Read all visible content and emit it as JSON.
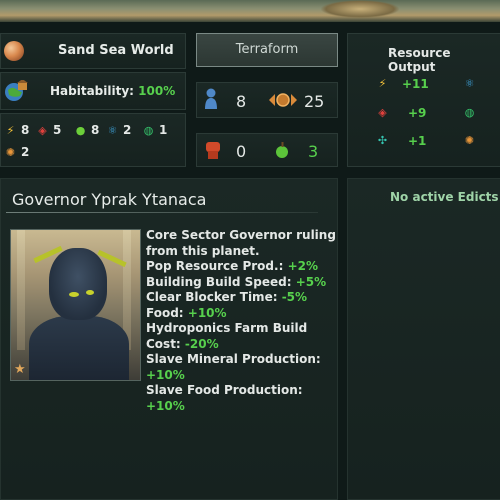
{
  "planet": {
    "name": "Sand Sea World",
    "habitability_label": "Habitability:",
    "habitability_value": "100%"
  },
  "resources": [
    {
      "icon": "energy-icon",
      "value": "8",
      "color": "#f3c23a"
    },
    {
      "icon": "minerals-icon",
      "value": "5",
      "color": "#e0403c"
    },
    {
      "icon": "food-icon",
      "value": "8",
      "color": "#6ccf3a"
    },
    {
      "icon": "research-icon",
      "value": "2",
      "color": "#3fa7e0"
    },
    {
      "icon": "trade-icon",
      "value": "1",
      "color": "#35c46b"
    },
    {
      "icon": "alloys-icon",
      "value": "2",
      "color": "#e8963a"
    }
  ],
  "terraform": {
    "label": "Terraform"
  },
  "pops": {
    "count": "8",
    "housing": "25"
  },
  "stability": {
    "unrest": "0",
    "food": "3"
  },
  "resource_output": {
    "title": "Resource Output",
    "rows": [
      {
        "icon": "energy-icon",
        "value": "+11"
      },
      {
        "icon": "minerals-icon",
        "value": "+9"
      },
      {
        "icon": "trade-icon",
        "value": "+1"
      }
    ],
    "right_icons": [
      "research-icon",
      "trade-icon",
      "alloys-icon"
    ]
  },
  "governor": {
    "title": "Governor Yprak Ytanaca",
    "description": "Core Sector Governor ruling from this planet.",
    "traits": [
      {
        "label": "Pop Resource Prod.:",
        "value": "+2%"
      },
      {
        "label": "Building Build Speed:",
        "value": "+5%"
      },
      {
        "label": "Clear Blocker Time:",
        "value": "-5%"
      },
      {
        "label": "Food:",
        "value": "+10%"
      },
      {
        "label": "Hydroponics Farm Build Cost:",
        "value": "-20%"
      },
      {
        "label": "Slave Mineral Production:",
        "value": "+10%"
      },
      {
        "label": "Slave Food Production:",
        "value": "+10%"
      }
    ]
  },
  "edicts": {
    "empty_label": "No active Edicts"
  }
}
